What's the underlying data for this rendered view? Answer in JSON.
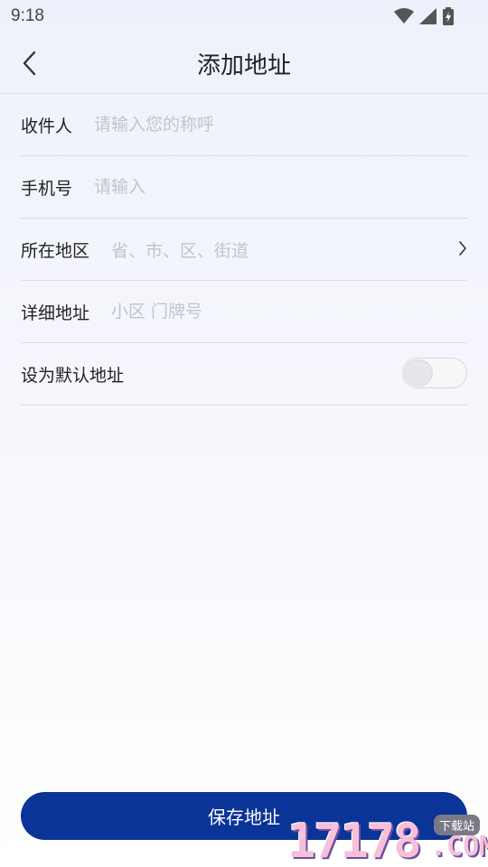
{
  "status_bar": {
    "time": "9:18",
    "icons": [
      "wifi-icon",
      "signal-icon",
      "battery-charging-icon"
    ]
  },
  "header": {
    "title": "添加地址",
    "back_icon": "chevron-left-icon"
  },
  "form": {
    "recipient": {
      "label": "收件人",
      "placeholder": "请输入您的称呼",
      "value": ""
    },
    "phone": {
      "label": "手机号",
      "placeholder": "请输入",
      "value": ""
    },
    "region": {
      "label": "所在地区",
      "placeholder": "省、市、区、街道",
      "icon": "chevron-right-icon"
    },
    "detail": {
      "label": "详细地址",
      "placeholder": "小区 门牌号",
      "value": ""
    },
    "default": {
      "label": "设为默认地址",
      "enabled": false
    }
  },
  "footer": {
    "save_label": "保存地址"
  },
  "watermark": {
    "digits": "17178",
    "suffix": ".COM",
    "tag": "下载站"
  },
  "colors": {
    "primary": "#0a3497",
    "placeholder": "#c2c4cb",
    "divider": "#dcdde2"
  }
}
